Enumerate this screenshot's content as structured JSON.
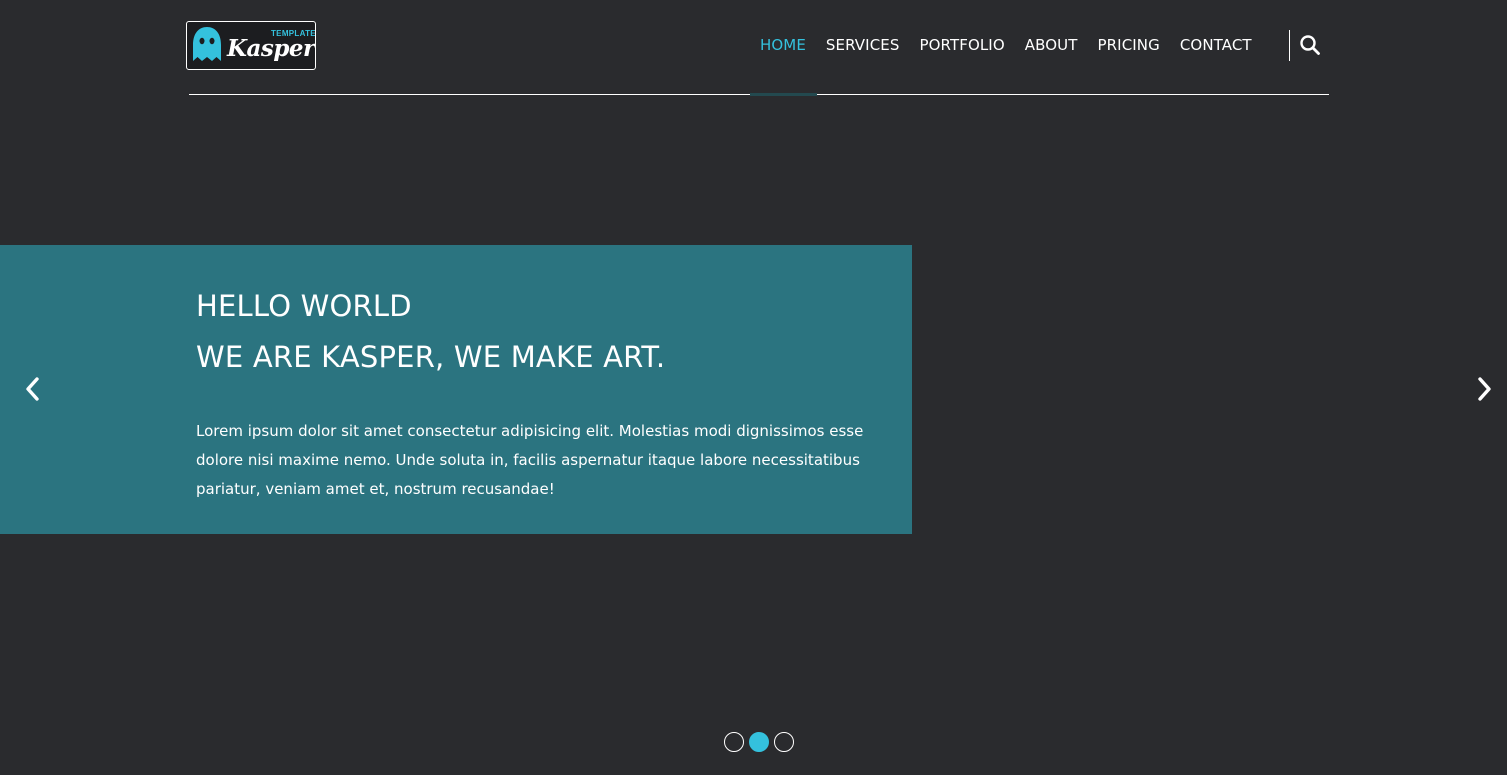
{
  "brand": {
    "logo_text": "Kasper",
    "logo_subtext": "TEMPLATE",
    "logo_icon": "ghost-icon"
  },
  "nav": {
    "items": [
      {
        "label": "HOME",
        "active": true
      },
      {
        "label": "SERVICES",
        "active": false
      },
      {
        "label": "PORTFOLIO",
        "active": false
      },
      {
        "label": "ABOUT",
        "active": false
      },
      {
        "label": "PRICING",
        "active": false
      },
      {
        "label": "CONTACT",
        "active": false
      }
    ],
    "search_icon": "search-icon"
  },
  "hero": {
    "title_line1": "HELLO WORLD",
    "title_line2": "WE ARE KASPER, WE MAKE ART.",
    "text": "Lorem ipsum dolor sit amet consectetur adipisicing elit. Molestias modi dignissimos esse dolore nisi maxime nemo. Unde soluta in, facilis aspernatur itaque labore necessitatibus pariatur, veniam amet et, nostrum recusandae!",
    "prev_icon": "chevron-left-icon",
    "next_icon": "chevron-right-icon"
  },
  "slider": {
    "slide_count": 3,
    "active_index": 1
  },
  "colors": {
    "background": "#2a2b2e",
    "accent": "#34c1dd",
    "slide_box": "#2b7480",
    "text": "#ffffff"
  }
}
